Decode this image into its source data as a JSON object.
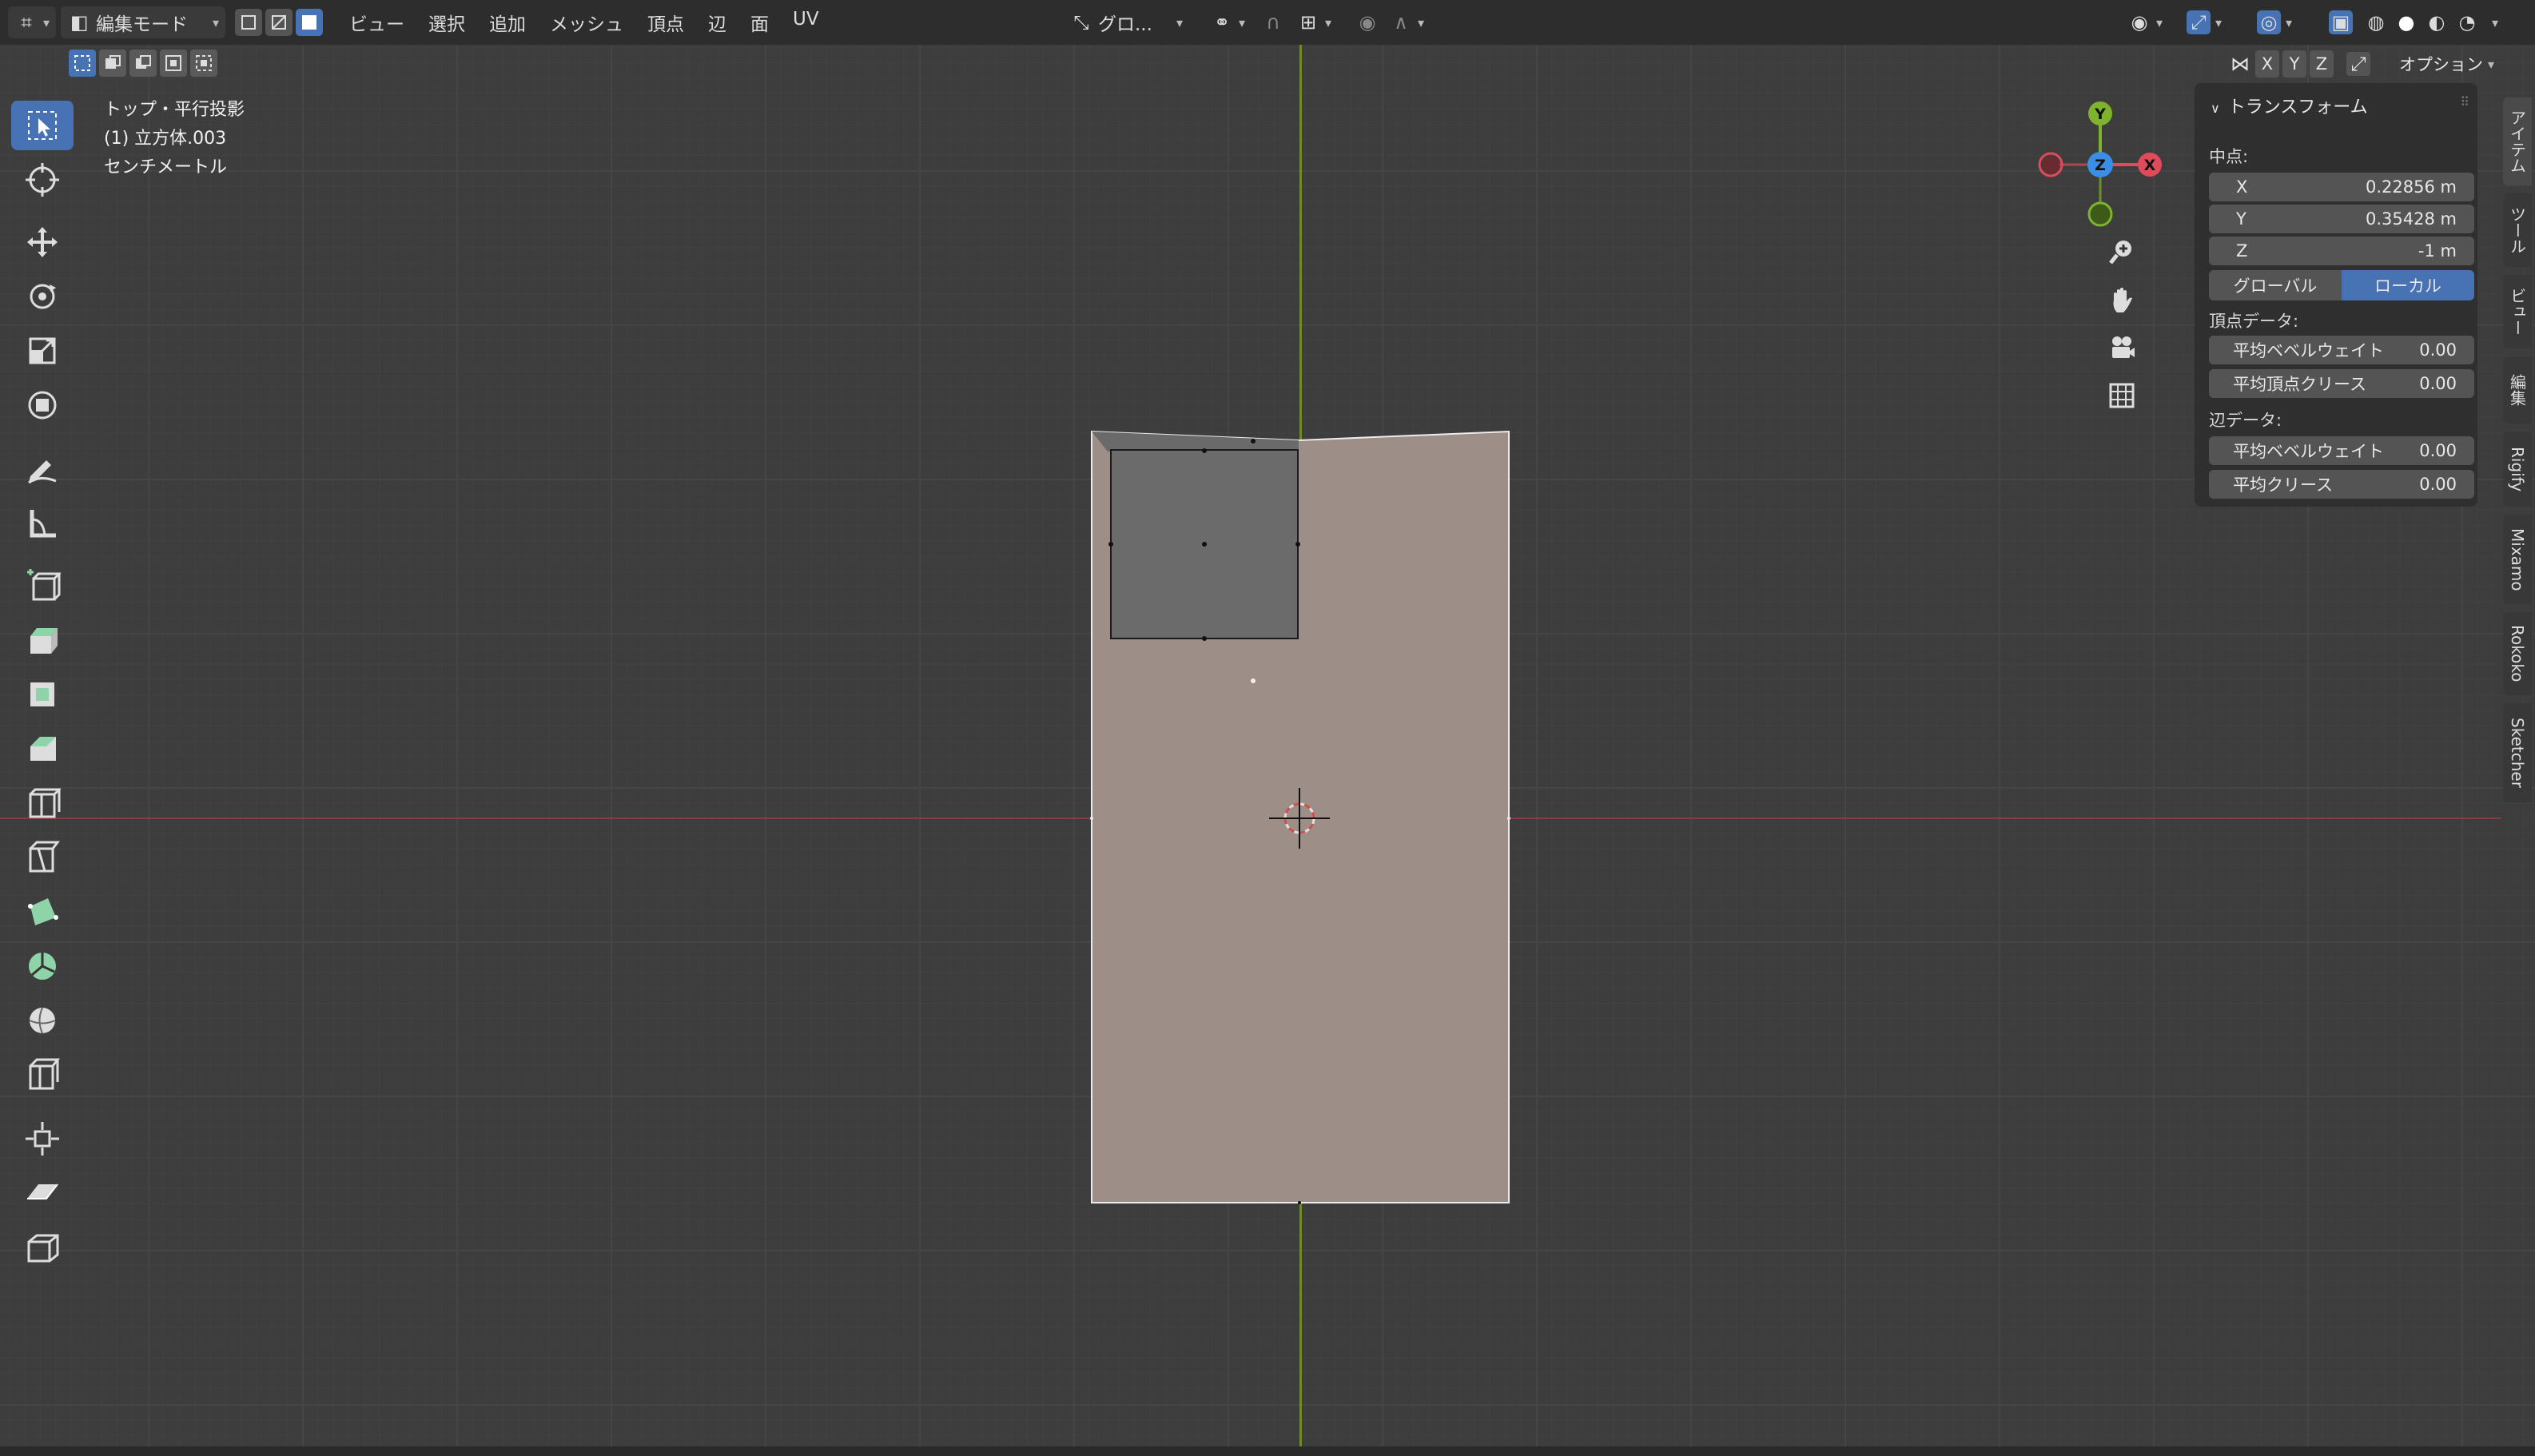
{
  "header": {
    "mode_label": "編集モード",
    "menus": [
      "ビュー",
      "選択",
      "追加",
      "メッシュ",
      "頂点",
      "辺",
      "面",
      "UV"
    ],
    "orientation_label": "グロ..."
  },
  "overlay": {
    "view_name": "トップ・平行投影",
    "object_name": "(1) 立方体.003",
    "units": "センチメートル"
  },
  "gizmo": {
    "x_label": "X",
    "y_label": "Y",
    "z_label": "Z"
  },
  "axis_lock": {
    "x": "X",
    "y": "Y",
    "z": "Z"
  },
  "options_label": "オプション",
  "npanel": {
    "section_title": "トランスフォーム",
    "median_label": "中点:",
    "fields": [
      {
        "label": "X",
        "value": "0.22856 m"
      },
      {
        "label": "Y",
        "value": "0.35428 m"
      },
      {
        "label": "Z",
        "value": "-1 m"
      }
    ],
    "space_global": "グローバル",
    "space_local": "ローカル",
    "vertex_data_label": "頂点データ:",
    "vertex_fields": [
      {
        "label": "平均ベベルウェイト",
        "value": "0.00"
      },
      {
        "label": "平均頂点クリース",
        "value": "0.00"
      }
    ],
    "edge_data_label": "辺データ:",
    "edge_fields": [
      {
        "label": "平均ベベルウェイト",
        "value": "0.00"
      },
      {
        "label": "平均クリース",
        "value": "0.00"
      }
    ]
  },
  "sidebar_tabs": [
    "アイテム",
    "ツール",
    "ビュー",
    "編集",
    "Rigify",
    "Mixamo",
    "Rokoko",
    "Sketcher"
  ],
  "colors": {
    "accent": "#4772b3",
    "axis_x": "#e04a5a",
    "axis_y": "#7fb32d",
    "axis_z": "#3a8ee6",
    "face": "#9d8e88",
    "selected_face": "#6b6b6b"
  }
}
